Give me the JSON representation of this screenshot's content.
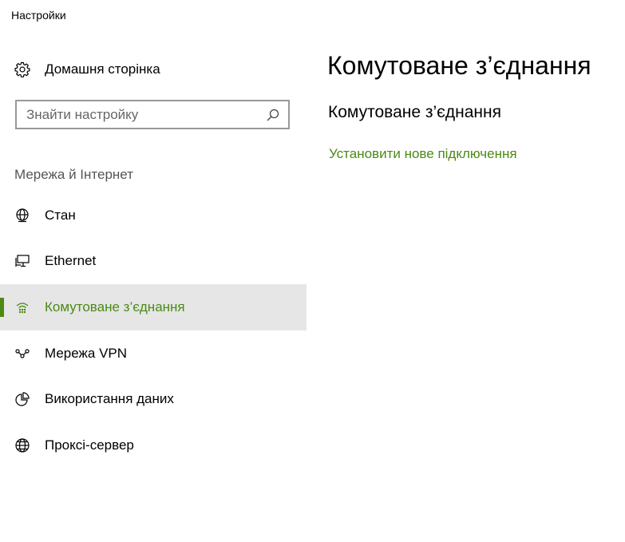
{
  "window": {
    "title": "Настройки"
  },
  "sidebar": {
    "home": {
      "label": "Домашня сторінка",
      "icon": "gear-icon"
    },
    "search": {
      "placeholder": "Знайти настройку",
      "value": "",
      "icon": "search-icon"
    },
    "section_heading": "Мережа й Інтернет",
    "items": [
      {
        "label": "Стан",
        "icon": "globe-status-icon",
        "selected": false
      },
      {
        "label": "Ethernet",
        "icon": "ethernet-icon",
        "selected": false
      },
      {
        "label": "Комутоване з’єднання",
        "icon": "dialup-icon",
        "selected": true
      },
      {
        "label": "Мережа VPN",
        "icon": "vpn-icon",
        "selected": false
      },
      {
        "label": "Використання даних",
        "icon": "data-usage-icon",
        "selected": false
      },
      {
        "label": "Проксі-сервер",
        "icon": "globe-proxy-icon",
        "selected": false
      }
    ]
  },
  "main": {
    "title": "Комутоване з’єднання",
    "section_title": "Комутоване з’єднання",
    "setup_link": "Установити нове підключення"
  },
  "colors": {
    "accent": "#4b8a14",
    "selected_background": "#e6e6e6",
    "search_border": "#999999",
    "heading_gray": "#555555"
  }
}
